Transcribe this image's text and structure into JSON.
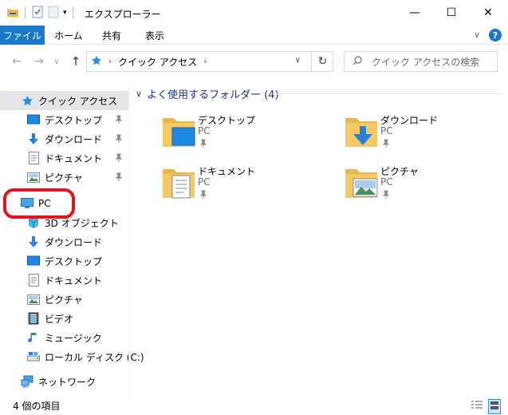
{
  "window": {
    "title": "エクスプローラー",
    "minimize": "—",
    "maximize": "☐",
    "close": "✕"
  },
  "ribbon": {
    "tabs": [
      "ファイル",
      "ホーム",
      "共有",
      "表示"
    ]
  },
  "address": {
    "path_root": "クイック アクセス",
    "search_placeholder": "クイック アクセスの検索"
  },
  "sidebar": {
    "quick_access": "クイック アクセス",
    "quick_items": [
      "デスクトップ",
      "ダウンロード",
      "ドキュメント",
      "ピクチャ"
    ],
    "pc": "PC",
    "pc_items": [
      "3D オブジェクト",
      "ダウンロード",
      "デスクトップ",
      "ドキュメント",
      "ピクチャ",
      "ビデオ",
      "ミュージック",
      "ローカル ディスク (C:)"
    ],
    "network": "ネットワーク"
  },
  "main": {
    "group_title": "よく使用するフォルダー (4)",
    "folders": [
      {
        "name": "デスクトップ",
        "location": "PC"
      },
      {
        "name": "ダウンロード",
        "location": "PC"
      },
      {
        "name": "ドキュメント",
        "location": "PC"
      },
      {
        "name": "ピクチャ",
        "location": "PC"
      }
    ]
  },
  "status": {
    "item_count": "4 個の項目"
  },
  "colors": {
    "accent": "#1979ca",
    "highlight": "#e3131b",
    "folder": "#f4c966",
    "group_title": "#1e3287"
  }
}
